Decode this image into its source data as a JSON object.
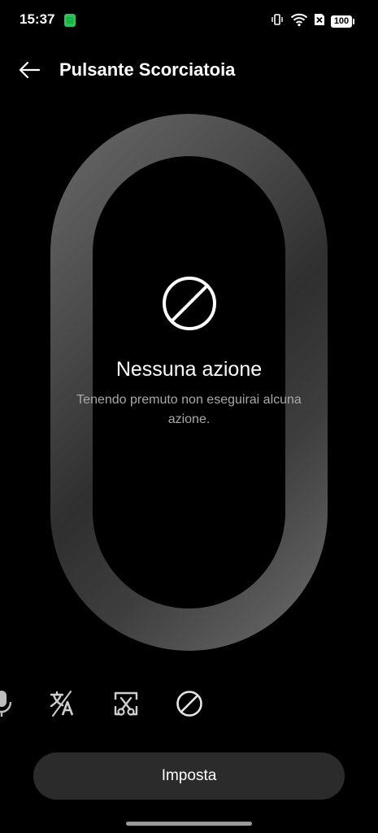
{
  "status_bar": {
    "time": "15:37",
    "battery_level": "100",
    "icons": [
      "app-notification-icon",
      "vibrate-icon",
      "wifi-icon",
      "sim-off-icon",
      "battery-icon"
    ]
  },
  "header": {
    "title": "Pulsante Scorciatoia",
    "back_icon": "arrow-left-icon"
  },
  "current_action": {
    "icon": "no-action-icon",
    "title": "Nessuna azione",
    "description": "Tenendo premuto non eseguirai alcuna azione."
  },
  "options": [
    {
      "icon": "microphone-icon"
    },
    {
      "icon": "translate-icon"
    },
    {
      "icon": "screenshot-scissors-icon"
    },
    {
      "icon": "no-action-icon",
      "selected": true
    }
  ],
  "set_button": {
    "label": "Imposta"
  },
  "colors": {
    "background": "#000000",
    "button": "#2b2b2b",
    "secondary_text": "#a8a8a8",
    "notification_badge": "#2fbf5b"
  }
}
